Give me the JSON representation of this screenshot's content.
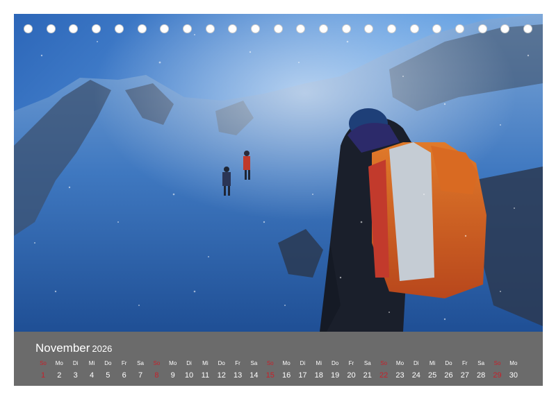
{
  "calendar": {
    "month": "November",
    "year": "2026",
    "sunday_color": "#c8202a",
    "days": [
      {
        "abbr": "So",
        "num": "1",
        "sunday": true
      },
      {
        "abbr": "Mo",
        "num": "2"
      },
      {
        "abbr": "Di",
        "num": "3"
      },
      {
        "abbr": "Mi",
        "num": "4"
      },
      {
        "abbr": "Do",
        "num": "5"
      },
      {
        "abbr": "Fr",
        "num": "6"
      },
      {
        "abbr": "Sa",
        "num": "7"
      },
      {
        "abbr": "So",
        "num": "8",
        "sunday": true
      },
      {
        "abbr": "Mo",
        "num": "9"
      },
      {
        "abbr": "Di",
        "num": "10"
      },
      {
        "abbr": "Mi",
        "num": "11"
      },
      {
        "abbr": "Do",
        "num": "12"
      },
      {
        "abbr": "Fr",
        "num": "13"
      },
      {
        "abbr": "Sa",
        "num": "14"
      },
      {
        "abbr": "So",
        "num": "15",
        "sunday": true
      },
      {
        "abbr": "Mo",
        "num": "16"
      },
      {
        "abbr": "Di",
        "num": "17"
      },
      {
        "abbr": "Mi",
        "num": "18"
      },
      {
        "abbr": "Do",
        "num": "19"
      },
      {
        "abbr": "Fr",
        "num": "20"
      },
      {
        "abbr": "Sa",
        "num": "21"
      },
      {
        "abbr": "So",
        "num": "22",
        "sunday": true
      },
      {
        "abbr": "Mo",
        "num": "23"
      },
      {
        "abbr": "Di",
        "num": "24"
      },
      {
        "abbr": "Mi",
        "num": "25"
      },
      {
        "abbr": "Do",
        "num": "26"
      },
      {
        "abbr": "Fr",
        "num": "27"
      },
      {
        "abbr": "Sa",
        "num": "28"
      },
      {
        "abbr": "So",
        "num": "29",
        "sunday": true
      },
      {
        "abbr": "Mo",
        "num": "30"
      }
    ]
  }
}
